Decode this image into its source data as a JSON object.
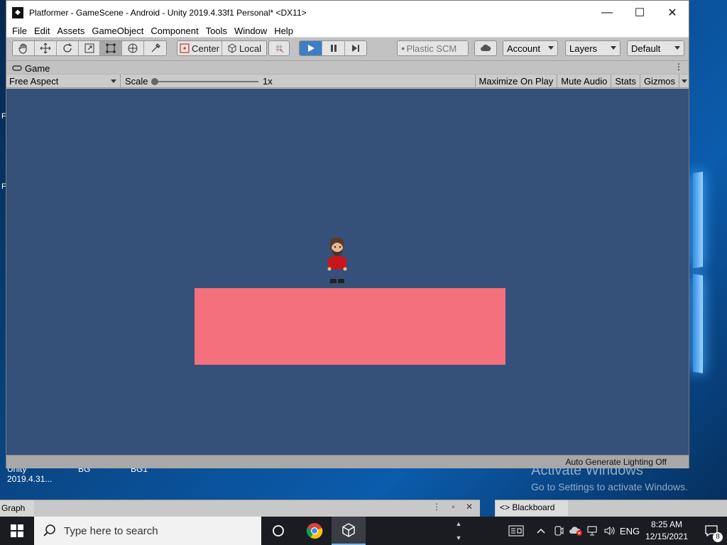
{
  "window": {
    "title": "Platformer - GameScene - Android - Unity 2019.4.33f1 Personal* <DX11>",
    "minimize_glyph": "—",
    "maximize_glyph": "☐",
    "close_glyph": "✕"
  },
  "menu": [
    "File",
    "Edit",
    "Assets",
    "GameObject",
    "Component",
    "Tools",
    "Window",
    "Help"
  ],
  "toolbar": {
    "tools": [
      "hand-icon",
      "move-icon",
      "rotate-icon",
      "scale-icon",
      "rect-transform-icon",
      "transform-icon",
      "custom-tool-icon"
    ],
    "pivot_mode": "Center",
    "pivot_rotation": "Local",
    "grid_snap_icon": "grid-snap-icon",
    "plastic_scm": "Plastic SCM",
    "account": "Account",
    "layers": "Layers",
    "layout": "Default"
  },
  "game_view": {
    "tab_label": "Game",
    "menu_glyph": "⋮",
    "aspect": "Free Aspect",
    "scale_label": "Scale",
    "scale_value": "1x",
    "maximize_on_play": "Maximize On Play",
    "mute_audio": "Mute Audio",
    "stats": "Stats",
    "gizmos": "Gizmos",
    "background_color": "#355079",
    "platform_color": "#f3707c"
  },
  "status_bar": {
    "text": "Auto Generate Lighting Off"
  },
  "background_panes": {
    "left_tab": "Graph",
    "right_tab": "<> Blackboard"
  },
  "desktop": {
    "icon_labels": [
      "Unity\n2019.4.31...",
      "BG",
      "BG1"
    ],
    "left_chars": [
      "F",
      "F"
    ],
    "activate_title": "Activate Windows",
    "activate_sub": "Go to Settings to activate Windows."
  },
  "taskbar": {
    "search_placeholder": "Type here to search",
    "language": "ENG",
    "time": "8:25 AM",
    "date": "12/15/2021",
    "notification_count": "8"
  }
}
